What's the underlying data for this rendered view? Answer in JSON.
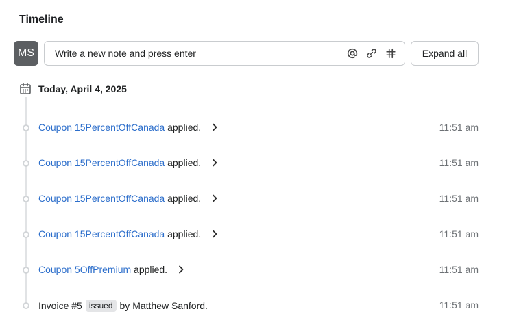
{
  "title": "Timeline",
  "avatar": {
    "initials": "MS"
  },
  "note": {
    "placeholder": "Write a new note and press enter"
  },
  "note_actions": [
    {
      "name": "mention-icon",
      "icon": "at-sign"
    },
    {
      "name": "attach-icon",
      "icon": "paperclip"
    },
    {
      "name": "hashtag-icon",
      "icon": "hash"
    }
  ],
  "expand_all_label": "Expand all",
  "day": {
    "label": "Today, April 4, 2025"
  },
  "events": [
    {
      "link": "Coupon 15PercentOffCanada",
      "text": "applied.",
      "time": "11:51 am"
    },
    {
      "link": "Coupon 15PercentOffCanada",
      "text": "applied.",
      "time": "11:51 am"
    },
    {
      "link": "Coupon 15PercentOffCanada",
      "text": "applied.",
      "time": "11:51 am"
    },
    {
      "link": "Coupon 15PercentOffCanada",
      "text": "applied.",
      "time": "11:51 am"
    },
    {
      "link": "Coupon 5OffPremium",
      "text": "applied.",
      "time": "11:51 am"
    }
  ],
  "invoice_event": {
    "prefix": "Invoice #5",
    "badge": "issued",
    "suffix": "by Matthew Sanford.",
    "time": "11:51 am"
  }
}
